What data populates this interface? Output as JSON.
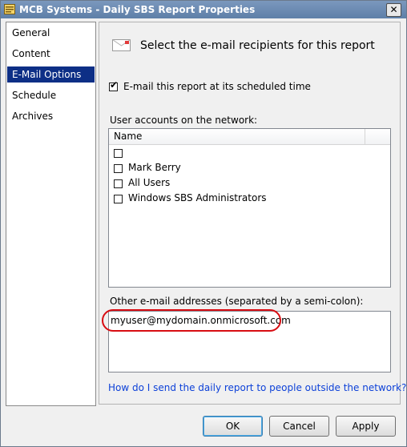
{
  "window": {
    "title": "MCB Systems - Daily SBS Report Properties",
    "close_label": "✕",
    "icon": "report-app-icon"
  },
  "nav": {
    "items": [
      {
        "label": "General"
      },
      {
        "label": "Content"
      },
      {
        "label": "E-Mail Options",
        "selected": true
      },
      {
        "label": "Schedule"
      },
      {
        "label": "Archives"
      }
    ]
  },
  "main": {
    "heading": "Select the e-mail recipients for this report",
    "heading_icon": "email-envelope-icon",
    "scheduled_checkbox": {
      "label": "E-mail this report at its scheduled time",
      "checked": true
    },
    "user_accounts_label": "User accounts on the network:",
    "list": {
      "column_header": "Name",
      "rows": [
        {
          "label": "",
          "checked": false
        },
        {
          "label": "Mark Berry",
          "checked": false
        },
        {
          "label": "All Users",
          "checked": false
        },
        {
          "label": "Windows SBS Administrators",
          "checked": false
        }
      ]
    },
    "other_addresses_label": "Other e-mail addresses (separated by a semi-colon):",
    "other_addresses_value": "myuser@mydomain.onmicrosoft.com",
    "help_link": "How do I send the daily report to people outside the network?"
  },
  "buttons": {
    "ok": "OK",
    "cancel": "Cancel",
    "apply": "Apply"
  },
  "colors": {
    "selection": "#0d2f86",
    "link": "#0d41d8",
    "annotation_oval": "#d80c12"
  }
}
